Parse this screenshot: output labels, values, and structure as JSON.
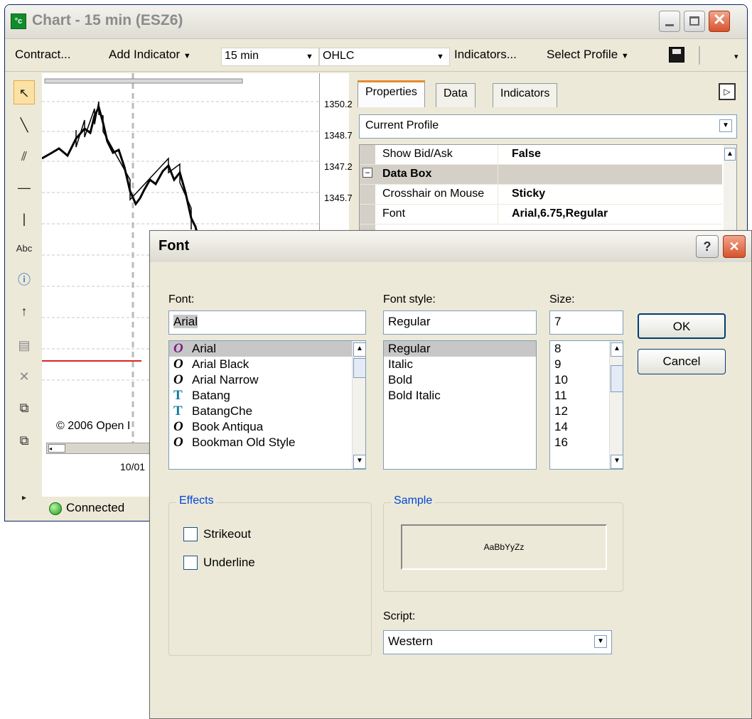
{
  "chart_window": {
    "title": "Chart - 15 min (ESZ6)",
    "toolbar": {
      "contract": "Contract...",
      "add_indicator": "Add Indicator",
      "interval": "15 min",
      "chart_type": "OHLC",
      "indicators": "Indicators...",
      "select_profile": "Select Profile"
    },
    "left_tools": {
      "text_tool_label": "Abc"
    },
    "price_axis": [
      "1350.25",
      "1348.75",
      "1347.25",
      "1345.75"
    ],
    "copyright": "© 2006 Open I",
    "date_label": "10/01",
    "status": "Connected",
    "panel": {
      "tabs": [
        "Properties",
        "Data",
        "Indicators"
      ],
      "profile": "Current Profile",
      "rows": [
        {
          "name": "Show Bid/Ask",
          "value": "False"
        },
        {
          "name": "Data Box",
          "value": ""
        },
        {
          "name": "Crosshair on Mouse",
          "value": "Sticky"
        },
        {
          "name": "Font",
          "value": "Arial,6.75,Regular"
        }
      ]
    }
  },
  "font_dialog": {
    "title": "Font",
    "help": "?",
    "font_label": "Font:",
    "font_value": "Arial",
    "fonts": [
      {
        "name": "Arial",
        "type": "O"
      },
      {
        "name": "Arial Black",
        "type": "O"
      },
      {
        "name": "Arial Narrow",
        "type": "O"
      },
      {
        "name": "Batang",
        "type": "T"
      },
      {
        "name": "BatangChe",
        "type": "T"
      },
      {
        "name": "Book Antiqua",
        "type": "O"
      },
      {
        "name": "Bookman Old Style",
        "type": "O"
      }
    ],
    "style_label": "Font style:",
    "style_value": "Regular",
    "styles": [
      "Regular",
      "Italic",
      "Bold",
      "Bold Italic"
    ],
    "size_label": "Size:",
    "size_value": "7",
    "sizes": [
      "8",
      "9",
      "10",
      "11",
      "12",
      "14",
      "16"
    ],
    "ok": "OK",
    "cancel": "Cancel",
    "effects_label": "Effects",
    "strikeout": "Strikeout",
    "underline": "Underline",
    "sample_label": "Sample",
    "sample_text": "AaBbYyZz",
    "script_label": "Script:",
    "script_value": "Western"
  }
}
